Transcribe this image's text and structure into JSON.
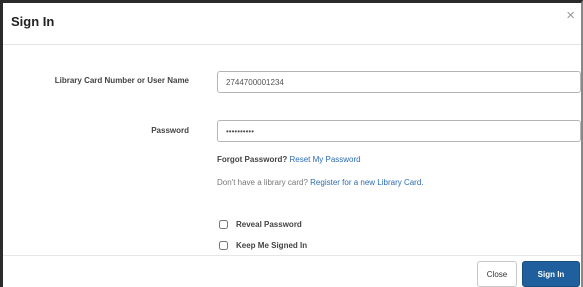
{
  "dialog": {
    "title": "Sign In",
    "close_glyph": "×"
  },
  "form": {
    "card_label": "Library Card Number or User Name",
    "card_value": "2744700001234",
    "password_label": "Password",
    "password_value": "••••••••••",
    "forgot_prefix": "Forgot Password?",
    "forgot_link": "Reset My Password",
    "register_prefix": "Don't have a library card?",
    "register_link": "Register for a new Library Card.",
    "reveal_label": "Reveal Password",
    "keep_label": "Keep Me Signed In"
  },
  "buttons": {
    "close_label": "Close",
    "signin_label": "Sign In"
  },
  "colors": {
    "primary": "#1f5f9e",
    "link": "#2a6cb3"
  }
}
